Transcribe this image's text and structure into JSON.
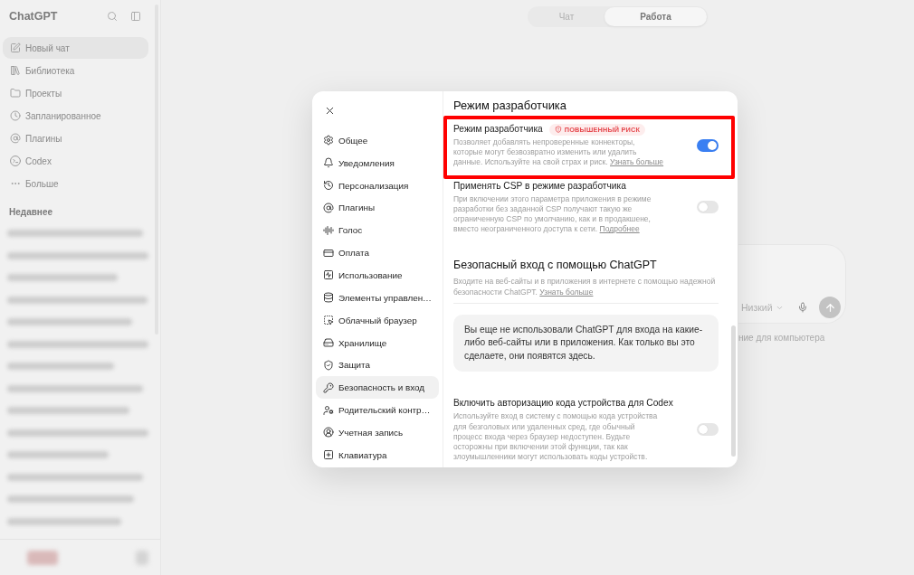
{
  "sidebar": {
    "title": "ChatGPT",
    "items": [
      {
        "label": "Новый чат",
        "selected": true
      },
      {
        "label": "Библиотека",
        "selected": false
      },
      {
        "label": "Проекты",
        "selected": false
      },
      {
        "label": "Запланированное",
        "selected": false
      },
      {
        "label": "Плагины",
        "selected": false
      },
      {
        "label": "Codex",
        "selected": false
      },
      {
        "label": "Больше",
        "selected": false
      }
    ],
    "recent_heading": "Недавнее"
  },
  "mode_switch": [
    {
      "label": "Чат",
      "selected": false
    },
    {
      "label": "Работа",
      "selected": true
    }
  ],
  "composer": {
    "effort": "Низкий",
    "note": "ние для компьютера"
  },
  "settings_dialog": {
    "nav": [
      {
        "label": "Общее",
        "selected": false
      },
      {
        "label": "Уведомления",
        "selected": false
      },
      {
        "label": "Персонализация",
        "selected": false
      },
      {
        "label": "Плагины",
        "selected": false
      },
      {
        "label": "Голос",
        "selected": false
      },
      {
        "label": "Оплата",
        "selected": false
      },
      {
        "label": "Использование",
        "selected": false
      },
      {
        "label": "Элементы управлен…",
        "selected": false
      },
      {
        "label": "Облачный браузер",
        "selected": false
      },
      {
        "label": "Хранилище",
        "selected": false
      },
      {
        "label": "Защита",
        "selected": false
      },
      {
        "label": "Безопасность и вход",
        "selected": true
      },
      {
        "label": "Родительский контр…",
        "selected": false
      },
      {
        "label": "Учетная запись",
        "selected": false
      },
      {
        "label": "Клавиатура",
        "selected": false
      }
    ],
    "title": "Режим разработчика",
    "sections": [
      {
        "kind": "toggle",
        "title": "Режим разработчика",
        "badge": "ПОВЫШЕННЫЙ РИСК",
        "description": "Позволяет добавлять непроверенные коннекторы, которые могут безвозвратно изменить или удалить данные. Используйте на свой страх и риск.",
        "link": "Узнать больше",
        "on": true,
        "highlighted": true
      },
      {
        "kind": "toggle",
        "title": "Применять CSP в режиме разработчика",
        "description": "При включении этого параметра приложения в режиме разработки без заданной CSP получают такую же ограниченную CSP по умолчанию, как и в продакшене, вместо неограниченного доступа к сети.",
        "link": "Подробнее",
        "on": false,
        "highlighted": false
      },
      {
        "kind": "info",
        "title": "Безопасный вход с помощью ChatGPT",
        "description": "Входите на веб-сайты и в приложения в интернете с помощью надежной безопасности ChatGPT.",
        "link": "Узнать больше",
        "note": "Вы еще не использовали ChatGPT для входа на какие-либо веб-сайты или в приложения. Как только вы это сделаете, они появятся здесь."
      },
      {
        "kind": "toggle",
        "title": "Включить авторизацию кода устройства для Codex",
        "description": "Используйте вход в систему с помощью кода устройства для безголовых или удаленных сред, где обычный процесс входа через браузер недоступен. Будьте осторожны при включении этой функции, так как злоумышленники могут использовать коды устройств.",
        "on": false,
        "highlighted": false
      }
    ]
  }
}
